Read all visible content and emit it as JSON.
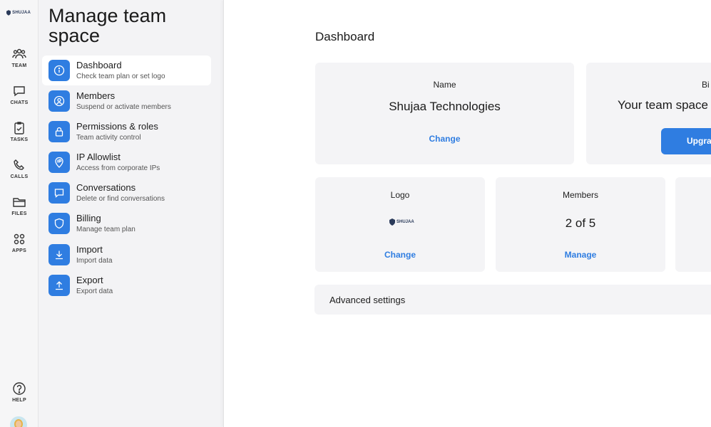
{
  "brand": {
    "logo_text": "SHUJAA"
  },
  "rail": {
    "items": [
      {
        "label": "TEAM",
        "icon": "team-icon"
      },
      {
        "label": "CHATS",
        "icon": "chat-icon"
      },
      {
        "label": "TASKS",
        "icon": "tasks-icon"
      },
      {
        "label": "CALLS",
        "icon": "phone-icon"
      },
      {
        "label": "FILES",
        "icon": "folder-icon"
      },
      {
        "label": "APPS",
        "icon": "apps-icon"
      }
    ],
    "help": {
      "label": "HELP",
      "icon": "help-icon"
    }
  },
  "menu": {
    "title": "Manage team space",
    "items": [
      {
        "title": "Dashboard",
        "subtitle": "Check team plan or set logo",
        "icon": "info-icon",
        "active": true
      },
      {
        "title": "Members",
        "subtitle": "Suspend or activate members",
        "icon": "user-icon"
      },
      {
        "title": "Permissions & roles",
        "subtitle": "Team activity control",
        "icon": "lock-icon"
      },
      {
        "title": "IP Allowlist",
        "subtitle": "Access from corporate IPs",
        "icon": "ip-icon"
      },
      {
        "title": "Conversations",
        "subtitle": "Delete or find conversations",
        "icon": "message-icon"
      },
      {
        "title": "Billing",
        "subtitle": "Manage team plan",
        "icon": "shield-icon"
      },
      {
        "title": "Import",
        "subtitle": "Import data",
        "icon": "download-icon"
      },
      {
        "title": "Export",
        "subtitle": "Export data",
        "icon": "upload-icon"
      }
    ]
  },
  "main": {
    "title": "Dashboard",
    "name_card": {
      "label": "Name",
      "value": "Shujaa Technologies",
      "link": "Change"
    },
    "billing_card": {
      "label": "Bi",
      "value": "Your team space",
      "button": "Upgra"
    },
    "logo_card": {
      "label": "Logo",
      "link": "Change"
    },
    "members_card": {
      "label": "Members",
      "value": "2 of 5",
      "link": "Manage"
    },
    "advanced": "Advanced settings"
  },
  "colors": {
    "accent": "#2f7de1",
    "card_bg": "#f4f4f6"
  }
}
